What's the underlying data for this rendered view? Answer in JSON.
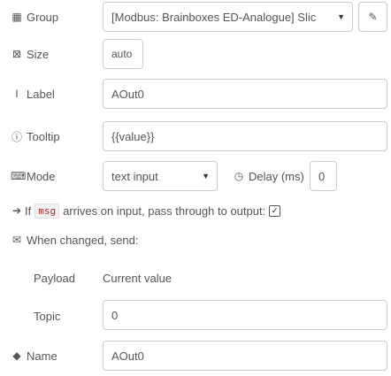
{
  "form": {
    "group": {
      "icon": "table-icon",
      "label": "Group",
      "value": "[Modbus: Brainboxes ED-Analogue] Slic"
    },
    "size": {
      "icon": "size-icon",
      "label": "Size",
      "value": "auto"
    },
    "label": {
      "icon": "text-cursor-icon",
      "label": "Label",
      "value": "AOut0"
    },
    "tooltip": {
      "icon": "info-icon",
      "label": "Tooltip",
      "value": "{{value}}"
    },
    "mode": {
      "icon": "keyboard-icon",
      "label": "Mode",
      "value": "text input"
    },
    "delay": {
      "icon": "clock-icon",
      "label": "Delay (ms)",
      "value": "0"
    },
    "passthrough": {
      "icon": "arrow-right-icon",
      "text_before": "If",
      "code": "msg",
      "text_after": "arrives on input, pass through to output:",
      "checked": true
    },
    "when_changed": {
      "icon": "envelope-icon",
      "label": "When changed, send:"
    },
    "payload": {
      "label": "Payload",
      "value": "Current value"
    },
    "topic": {
      "label": "Topic",
      "value": "0"
    },
    "name": {
      "icon": "tag-icon",
      "label": "Name",
      "value": "AOut0"
    }
  }
}
